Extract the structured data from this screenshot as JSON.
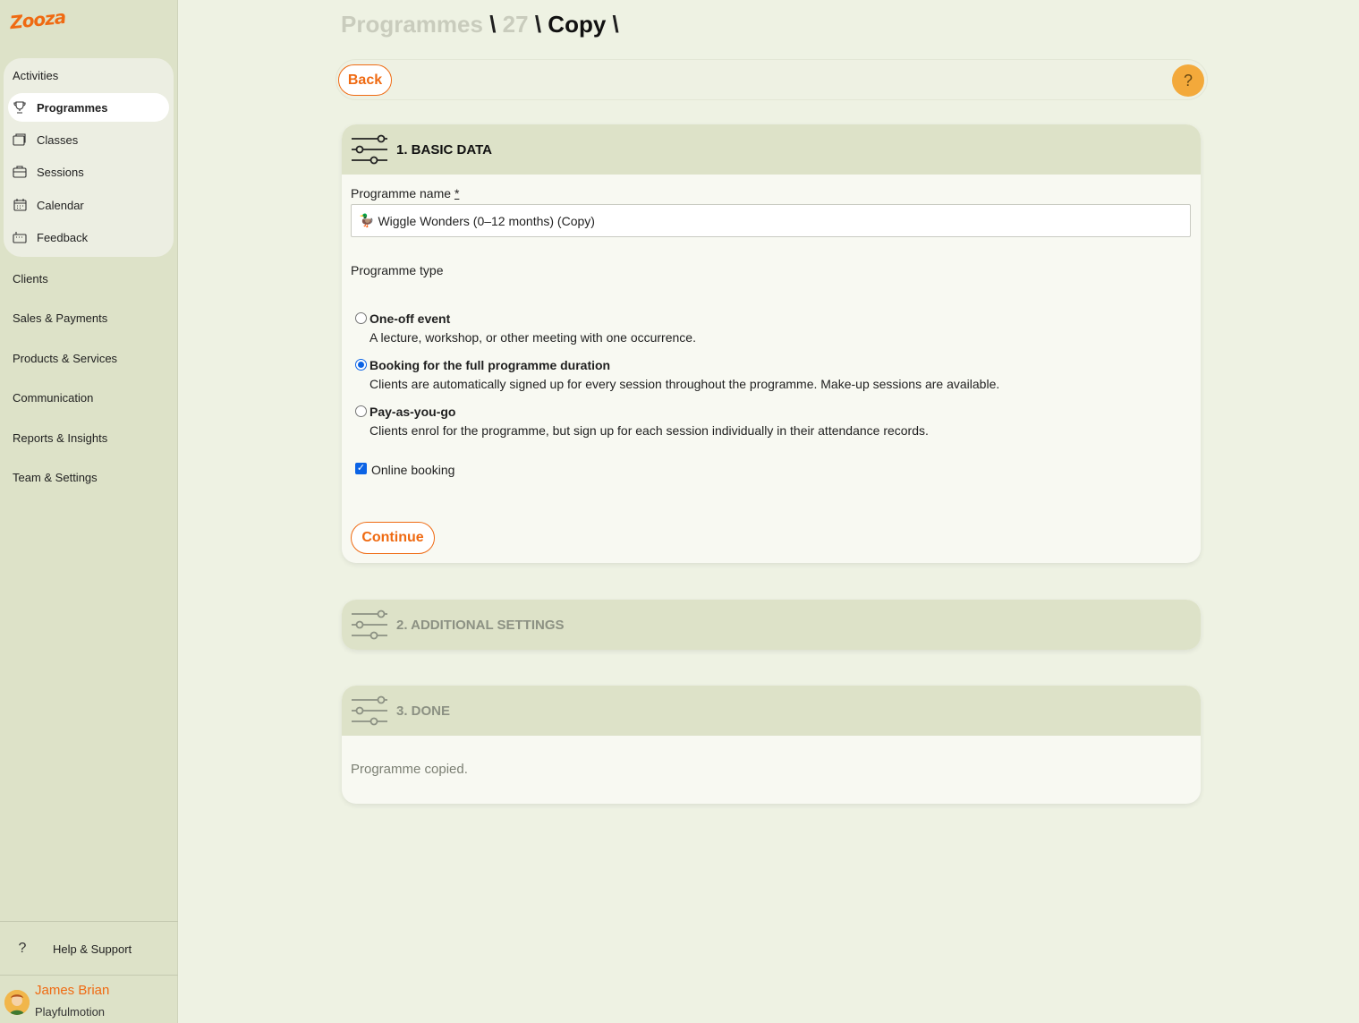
{
  "brand": {
    "logo_text": "Zooza",
    "accent": "#ef6a12"
  },
  "sidebar": {
    "activities_title": "Activities",
    "activities_items": [
      {
        "label": "Programmes",
        "icon": "trophy-icon",
        "active": true
      },
      {
        "label": "Classes",
        "icon": "folder-icon",
        "active": false
      },
      {
        "label": "Sessions",
        "icon": "briefcase-icon",
        "active": false
      },
      {
        "label": "Calendar",
        "icon": "calendar-icon",
        "active": false
      },
      {
        "label": "Feedback",
        "icon": "feedback-icon",
        "active": false
      }
    ],
    "nav_items": [
      "Clients",
      "Sales & Payments",
      "Products & Services",
      "Communication",
      "Reports & Insights",
      "Team & Settings"
    ],
    "help_label": "Help & Support",
    "help_icon": "?",
    "user": {
      "name": "James Brian",
      "org": "Playfulmotion"
    }
  },
  "breadcrumb": {
    "programmes": "Programmes",
    "id": "27",
    "current": "Copy",
    "separator": "\\"
  },
  "toolbar": {
    "back_label": "Back",
    "help_label": "?"
  },
  "step1": {
    "title": "1. BASIC DATA",
    "name_label": "Programme name",
    "required_mark": "*",
    "name_value": "Wiggle Wonders (0–12 months) (Copy)",
    "name_emoji": "🦆",
    "type_label": "Programme type",
    "options": [
      {
        "label": "One-off event",
        "desc": "A lecture, workshop, or other meeting with one occurrence.",
        "checked": false
      },
      {
        "label": "Booking for the full programme duration",
        "desc": "Clients are automatically signed up for every session throughout the programme. Make-up sessions are available.",
        "checked": true
      },
      {
        "label": "Pay-as-you-go",
        "desc": "Clients enrol for the programme, but sign up for each session individually in their attendance records.",
        "checked": false
      }
    ],
    "online_booking_label": "Online booking",
    "online_booking_checked": true,
    "continue_label": "Continue"
  },
  "step2": {
    "title": "2. ADDITIONAL SETTINGS"
  },
  "step3": {
    "title": "3. DONE",
    "body": "Programme copied."
  }
}
